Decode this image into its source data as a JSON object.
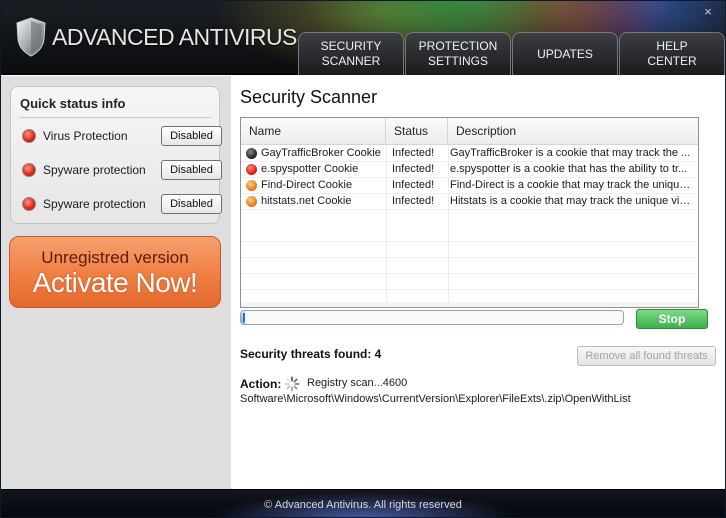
{
  "app": {
    "title": "ADVANCED ANTIVIRUS",
    "close_glyph": "×"
  },
  "nav": {
    "tabs": [
      {
        "label": "SECURITY\nSCANNER"
      },
      {
        "label": "PROTECTION\nSETTINGS"
      },
      {
        "label": "UPDATES"
      },
      {
        "label": "HELP\nCENTER"
      }
    ]
  },
  "sidebar": {
    "status_title": "Quick status info",
    "status_items": [
      {
        "label": "Virus Protection",
        "button": "Disabled",
        "icon": "red-status-icon"
      },
      {
        "label": "Spyware protection",
        "button": "Disabled",
        "icon": "red-status-icon"
      },
      {
        "label": "Spyware protection",
        "button": "Disabled",
        "icon": "red-status-icon"
      }
    ],
    "activate": {
      "line1": "Unregistred version",
      "line2": "Activate Now!"
    }
  },
  "main": {
    "title": "Security Scanner",
    "table": {
      "columns": [
        "Name",
        "Status",
        "Description"
      ],
      "rows": [
        {
          "name": "GayTrafficBroker Cookie",
          "status": "Infected!",
          "description": "GayTrafficBroker is a cookie that may track the ...",
          "severity": "critical"
        },
        {
          "name": "e.spyspotter Cookie",
          "status": "Infected!",
          "description": "e.spyspotter is a cookie that has the ability to tr...",
          "severity": "high"
        },
        {
          "name": "Find-Direct Cookie",
          "status": "Infected!",
          "description": "Find-Direct is a cookie that may track the unique...",
          "severity": "medium"
        },
        {
          "name": "hitstats.net Cookie",
          "status": "Infected!",
          "description": "Hitstats is a cookie that may track the unique vis...",
          "severity": "medium"
        }
      ]
    },
    "progress": 0.01,
    "stop_label": "Stop",
    "threats_found": "Security threats found: 4",
    "remove_label": "Remove all found threats",
    "action_label": "Action:",
    "action_text": "Registry scan...4600",
    "scan_path": "Software\\Microsoft\\Windows\\CurrentVersion\\Explorer\\FileExts\\.zip\\OpenWithList"
  },
  "footer": {
    "text": "© Advanced Antivirus. All rights reserved"
  },
  "colors": {
    "accent_green": "#3fae4c",
    "activate_orange": "#f07e42",
    "status_red": "#e4291a"
  }
}
